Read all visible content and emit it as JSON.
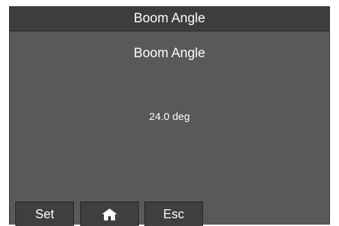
{
  "window": {
    "title": "Boom Angle"
  },
  "main": {
    "heading": "Boom Angle",
    "value": "24.0 deg"
  },
  "softkeys": {
    "set_label": "Set",
    "home_icon": "home-icon",
    "esc_label": "Esc"
  },
  "colors": {
    "background": "#58595b",
    "titlebar": "#3d3d3d",
    "button": "#3f3f3f",
    "text": "#ffffff"
  }
}
